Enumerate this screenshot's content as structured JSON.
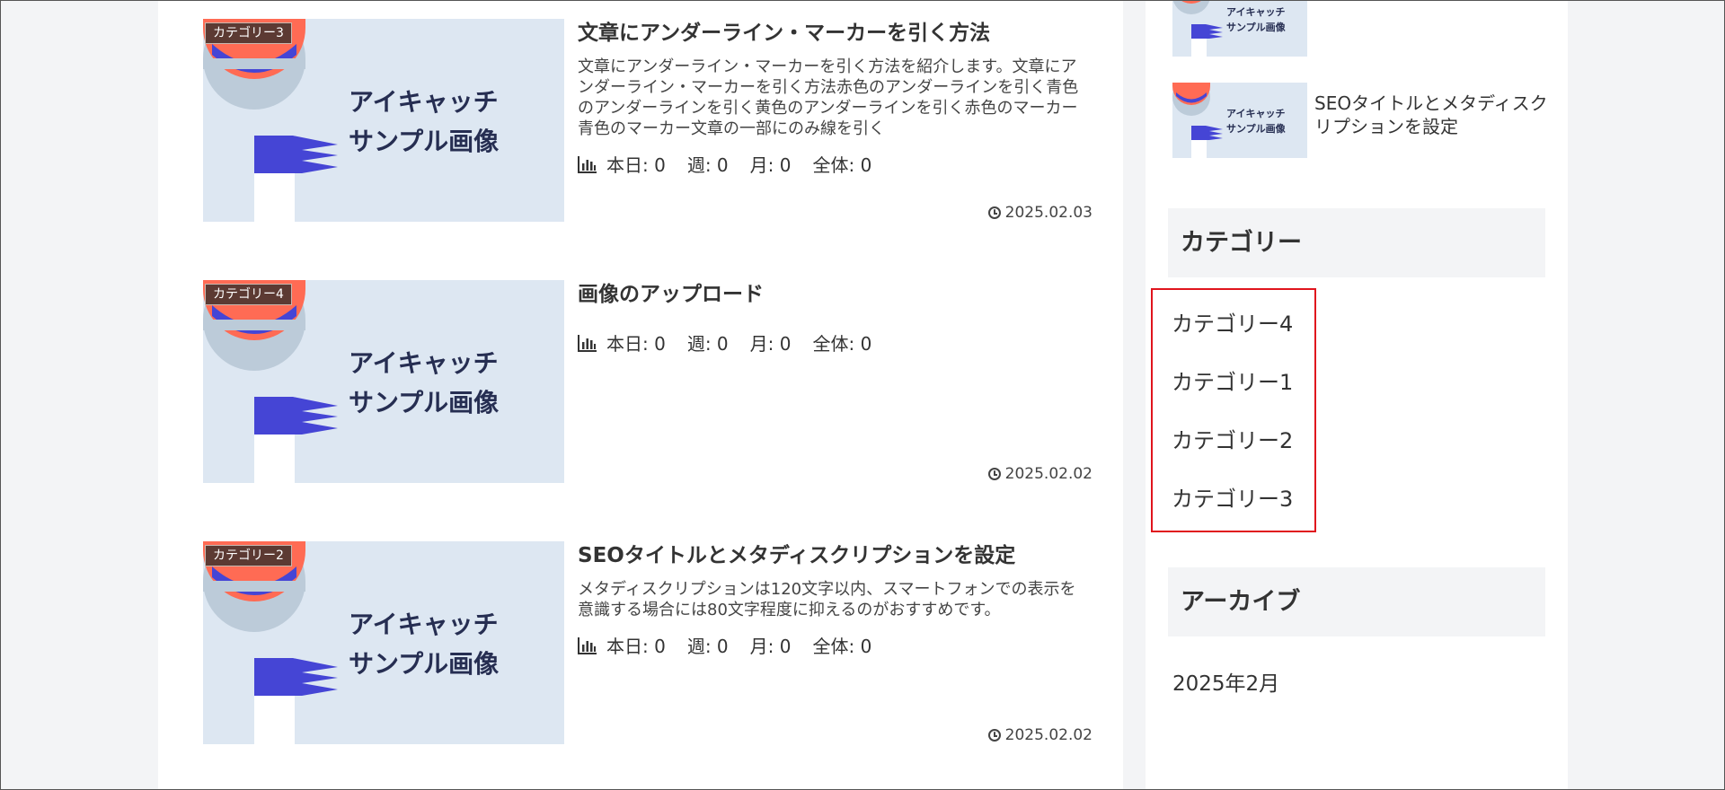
{
  "posts": [
    {
      "category": "カテゴリー3",
      "title": "文章にアンダーライン・マーカーを引く方法",
      "snippet": "文章にアンダーライン・マーカーを引く方法を紹介します。文章にアンダーライン・マーカーを引く方法赤色のアンダーラインを引く青色のアンダーラインを引く黄色のアンダーラインを引く赤色のマーカー青色のマーカー文章の一部にのみ線を引く",
      "stats": {
        "today": "本日: 0",
        "week": "週: 0",
        "month": "月: 0",
        "total": "全体: 0"
      },
      "date": "2025.02.03"
    },
    {
      "category": "カテゴリー4",
      "title": "画像のアップロード",
      "snippet": "",
      "stats": {
        "today": "本日: 0",
        "week": "週: 0",
        "month": "月: 0",
        "total": "全体: 0"
      },
      "date": "2025.02.02"
    },
    {
      "category": "カテゴリー2",
      "title": "SEOタイトルとメタディスクリプションを設定",
      "snippet": "メタディスクリプションは120文字以内、スマートフォンでの表示を意識する場合には80文字程度に抑えるのがおすすめです。",
      "stats": {
        "today": "本日: 0",
        "week": "週: 0",
        "month": "月: 0",
        "total": "全体: 0"
      },
      "date": "2025.02.02"
    }
  ],
  "thumbnail": {
    "line1": "アイキャッチ",
    "line2": "サンプル画像"
  },
  "sidebar": {
    "recent_posts": [
      {
        "title": ""
      },
      {
        "title": "SEOタイトルとメタディスクリプションを設定"
      }
    ],
    "categories_title": "カテゴリー",
    "categories": [
      "カテゴリー4",
      "カテゴリー1",
      "カテゴリー2",
      "カテゴリー3"
    ],
    "archives_title": "アーカイブ",
    "archives": [
      "2025年2月"
    ]
  },
  "colors": {
    "accent_coral": "#ff6b54",
    "accent_blue": "#4040d0",
    "thumb_bg": "#dde7f2",
    "highlight_border": "#e0141d"
  }
}
